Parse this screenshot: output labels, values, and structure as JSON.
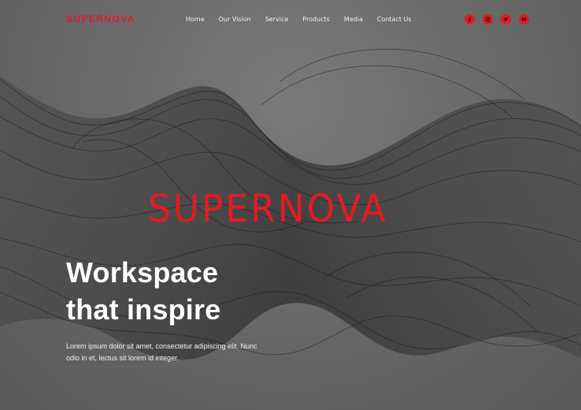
{
  "header": {
    "brand": "SUPERNOVA",
    "nav": [
      "Home",
      "Our Vision",
      "Service",
      "Products",
      "Media",
      "Contact Us"
    ],
    "socials": [
      {
        "name": "facebook-icon"
      },
      {
        "name": "instagram-icon"
      },
      {
        "name": "twitter-icon"
      },
      {
        "name": "youtube-icon"
      }
    ]
  },
  "hero": {
    "logo": "SUPERNOVA",
    "title_line_1": "Workspace",
    "title_line_2": "that inspire",
    "description_line_1": "Lorem ipsum dolor sit amet, consectetur adipiscing elit. Nunc",
    "description_line_2": "odio in et, lectus sit lorem id integer."
  },
  "colors": {
    "accent": "#e31b23",
    "background": "#6b6b6b",
    "text": "#ffffff"
  }
}
